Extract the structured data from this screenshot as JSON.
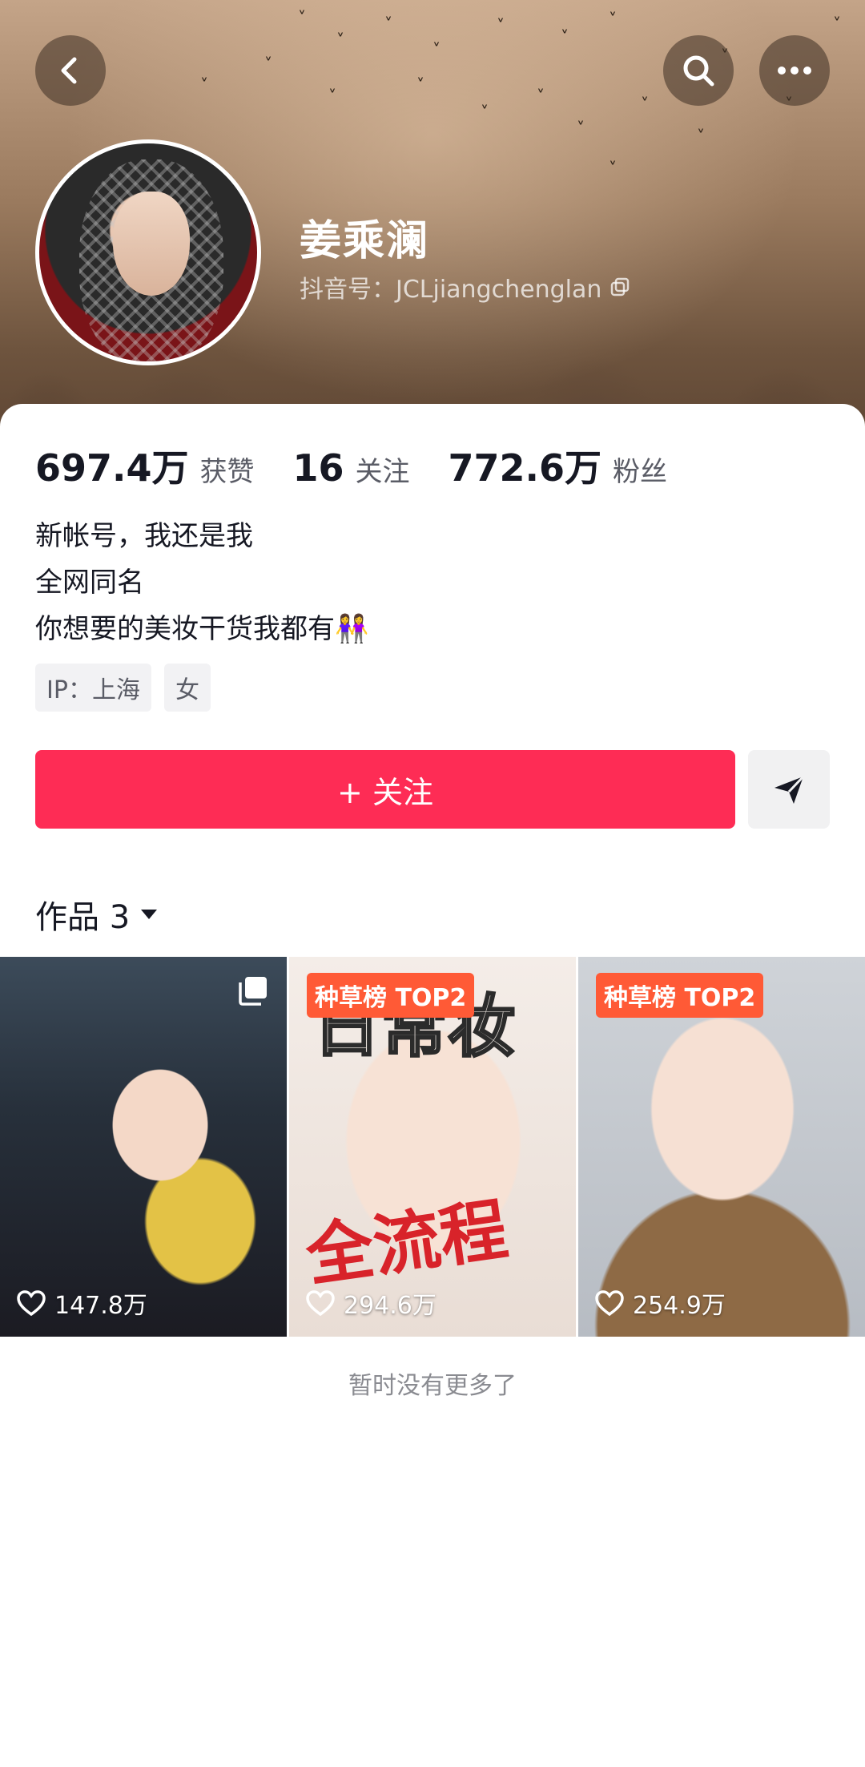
{
  "profile": {
    "name": "姜乘澜",
    "douyin_id": "抖音号：JCLjiangchenglan"
  },
  "stats": [
    {
      "value": "697.4万",
      "label": "获赞"
    },
    {
      "value": "16",
      "label": "关注"
    },
    {
      "value": "772.6万",
      "label": "粉丝"
    }
  ],
  "bio": {
    "line1": "新帐号，我还是我",
    "line2": "全网同名",
    "line3": "你想要的美妆干货我都有👭"
  },
  "tags": [
    "IP：上海",
    "女"
  ],
  "actions": {
    "follow_label": "+ 关注"
  },
  "works": {
    "title": "作品 3",
    "items": [
      {
        "likes": "147.8万",
        "badge": "",
        "overlay_text": ""
      },
      {
        "likes": "294.6万",
        "badge": "种草榜 TOP2",
        "overlay_text_top": "日常妆",
        "overlay_text_bottom": "全流程"
      },
      {
        "likes": "254.9万",
        "badge": "种草榜 TOP2",
        "overlay_text": ""
      }
    ],
    "end_text": "暂时没有更多了"
  },
  "colors": {
    "accent": "#fe2c55",
    "badge": "#ff5a36"
  },
  "icons": [
    "back-icon",
    "search-icon",
    "more-icon",
    "copy-icon",
    "send-icon",
    "dropdown-triangle-icon",
    "heart-icon",
    "multi-image-icon"
  ]
}
